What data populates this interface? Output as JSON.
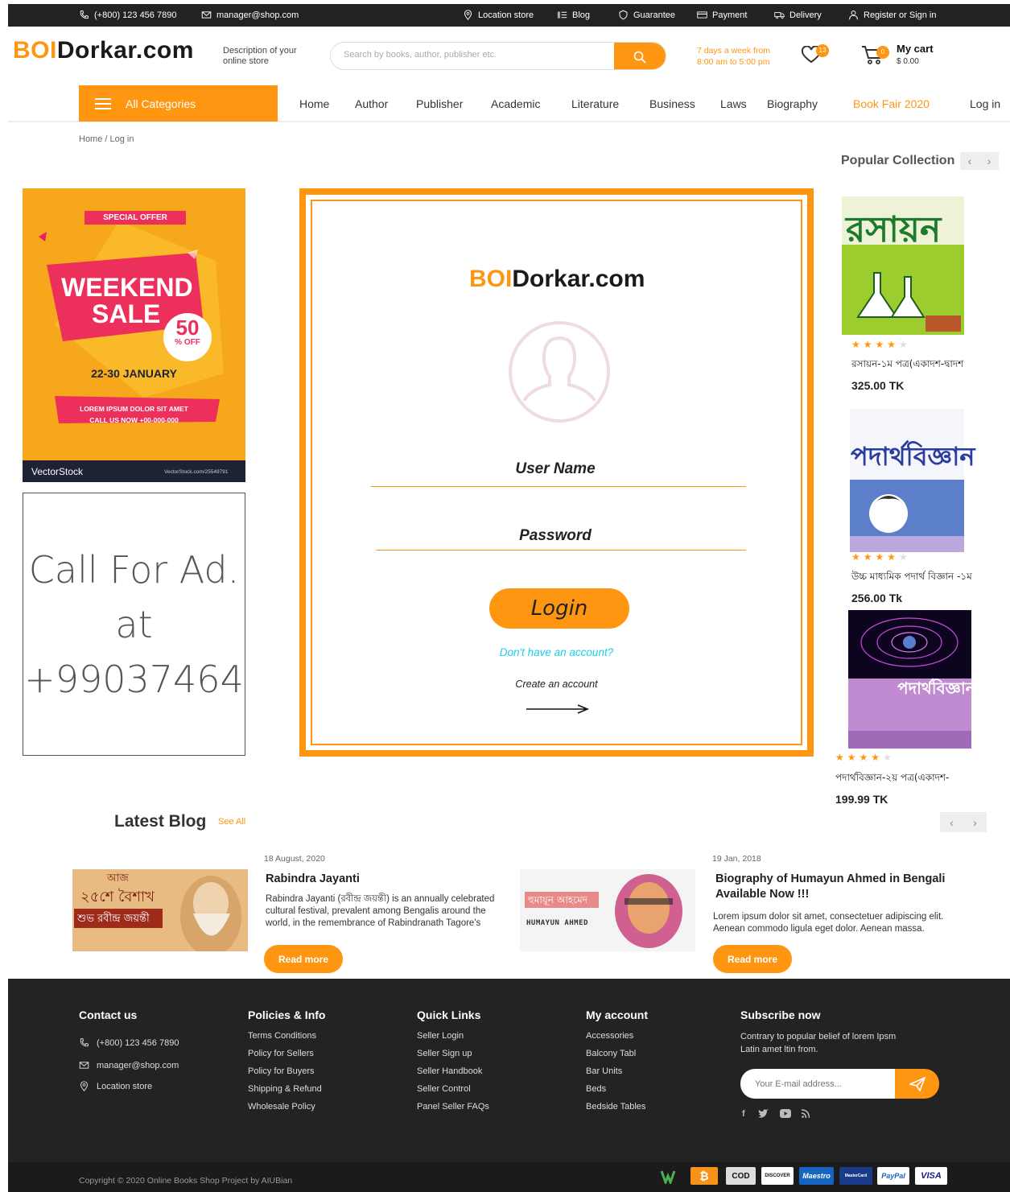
{
  "colors": {
    "accent": "#fe9611",
    "dark": "#232323",
    "link_cyan": "#1ccfe8"
  },
  "topbar": {
    "phone": "(+800) 123 456 7890",
    "email": "manager@shop.com",
    "location": "Location store",
    "blog": "Blog",
    "guarantee": "Guarantee",
    "payment": "Payment",
    "delivery": "Delivery",
    "register": "Register or Sign in"
  },
  "header": {
    "logo_part1": "BOI",
    "logo_part2": "Dorkar.com",
    "store_desc": "Description of your online store",
    "search_placeholder": "Search by books, author, publisher etc.",
    "hours_line1": "7 days a week from",
    "hours_line2": "8:00 am to 5:00 pm",
    "wishlist_count": "13",
    "cart_count": "0",
    "cart_title": "My cart",
    "cart_amount": "$ 0.00"
  },
  "nav": {
    "categories": "All Categories",
    "items": [
      "Home",
      "Author",
      "Publisher",
      "Academic",
      "Literature",
      "Business",
      "Laws",
      "Biography",
      "Book Fair 2020",
      "Log in"
    ]
  },
  "breadcrumb": "Home / Log in",
  "ads": {
    "ad1": {
      "special": "SPECIAL OFFER",
      "weekend": "WEEKEND",
      "sale": "SALE",
      "pct": "50",
      "off": "% OFF",
      "dates": "22-30 JANUARY",
      "lorem1": "LOREM IPSUM DOLOR SIT AMET",
      "lorem2": "CALL US NOW +00-000-000",
      "brand": "VectorStock",
      "url": "VectorStock.com/25549791"
    },
    "ad2": {
      "line1": "Call For Ad.",
      "line2": "at",
      "line3": "+99037464"
    }
  },
  "login": {
    "logo_part1": "BOI",
    "logo_part2": "Dorkar.com",
    "username_label": "User Name",
    "password_label": "Password",
    "button": "Login",
    "no_account": "Don't have an account?",
    "create": "Create an account"
  },
  "popular": {
    "title": "Popular Collection",
    "products": [
      {
        "name": "রসায়ন-১ম পত্র(একাদশ-দ্বাদশ",
        "price": "325.00 TK",
        "rating": 4,
        "cover_title": "রসায়ন"
      },
      {
        "name": "উচ্চ মাধ্যমিক পদার্থ বিজ্ঞান -১ম",
        "price": "256.00 Tk",
        "rating": 4,
        "cover_title": "পদার্থবিজ্ঞান"
      },
      {
        "name": "পদার্থবিজ্ঞান-২য় পত্র(একাদশ-",
        "price": "199.99 TK",
        "rating": 4,
        "cover_title": "পদার্থবিজ্ঞান"
      }
    ]
  },
  "blog": {
    "title": "Latest Blog",
    "see_all": "See All",
    "posts": [
      {
        "date": "18 August, 2020",
        "title": "Rabindra Jayanti",
        "text": "Rabindra Jayanti (রবীন্দ্র জয়ন্তী) is an annually celebrated cultural festival, prevalent among Bengalis around the world, in the remembrance of Rabindranath Tagore's",
        "button": "Read more",
        "img_line1": "আজ",
        "img_line2": "২৫শে বৈশাখ",
        "img_line3": "শুভ রবীন্দ্র জয়ন্তী"
      },
      {
        "date": "19 Jan, 2018",
        "title": "Biography of Humayun Ahmed in Bengali Available Now !!!",
        "text": "Lorem ipsum dolor sit amet, consectetuer adipiscing elit. Aenean commodo ligula eget dolor. Aenean massa.",
        "button": "Read more",
        "img_line1": "হুমায়ূন আহমেদ",
        "img_line2": "HUMAYUN AHMED"
      }
    ]
  },
  "footer": {
    "contact": {
      "title": "Contact us",
      "phone": "(+800) 123 456 7890",
      "email": "manager@shop.com",
      "location": "Location store"
    },
    "policies": {
      "title": "Policies & Info",
      "links": [
        "Terms Conditions",
        "Policy for Sellers",
        "Policy for Buyers",
        "Shipping & Refund",
        "Wholesale Policy"
      ]
    },
    "quick": {
      "title": "Quick Links",
      "links": [
        "Seller Login",
        "Seller Sign up",
        "Seller Handbook",
        "Seller Control",
        "Panel Seller FAQs"
      ]
    },
    "account": {
      "title": "My account",
      "links": [
        "Accessories",
        "Balcony Tabl",
        "Bar Units",
        "Beds",
        "Bedside Tables"
      ]
    },
    "subscribe": {
      "title": "Subscribe now",
      "text": "Contrary to popular belief of lorem Ipsm Latin amet ltin from.",
      "placeholder": "Your E-mail address..."
    },
    "copyright": "Copyright © 2020 Online Books Shop Project by AIUBian",
    "payments": [
      "₿",
      "COD",
      "DISCOVER",
      "Maestro",
      "MasterCard",
      "PayPal",
      "VISA"
    ]
  }
}
